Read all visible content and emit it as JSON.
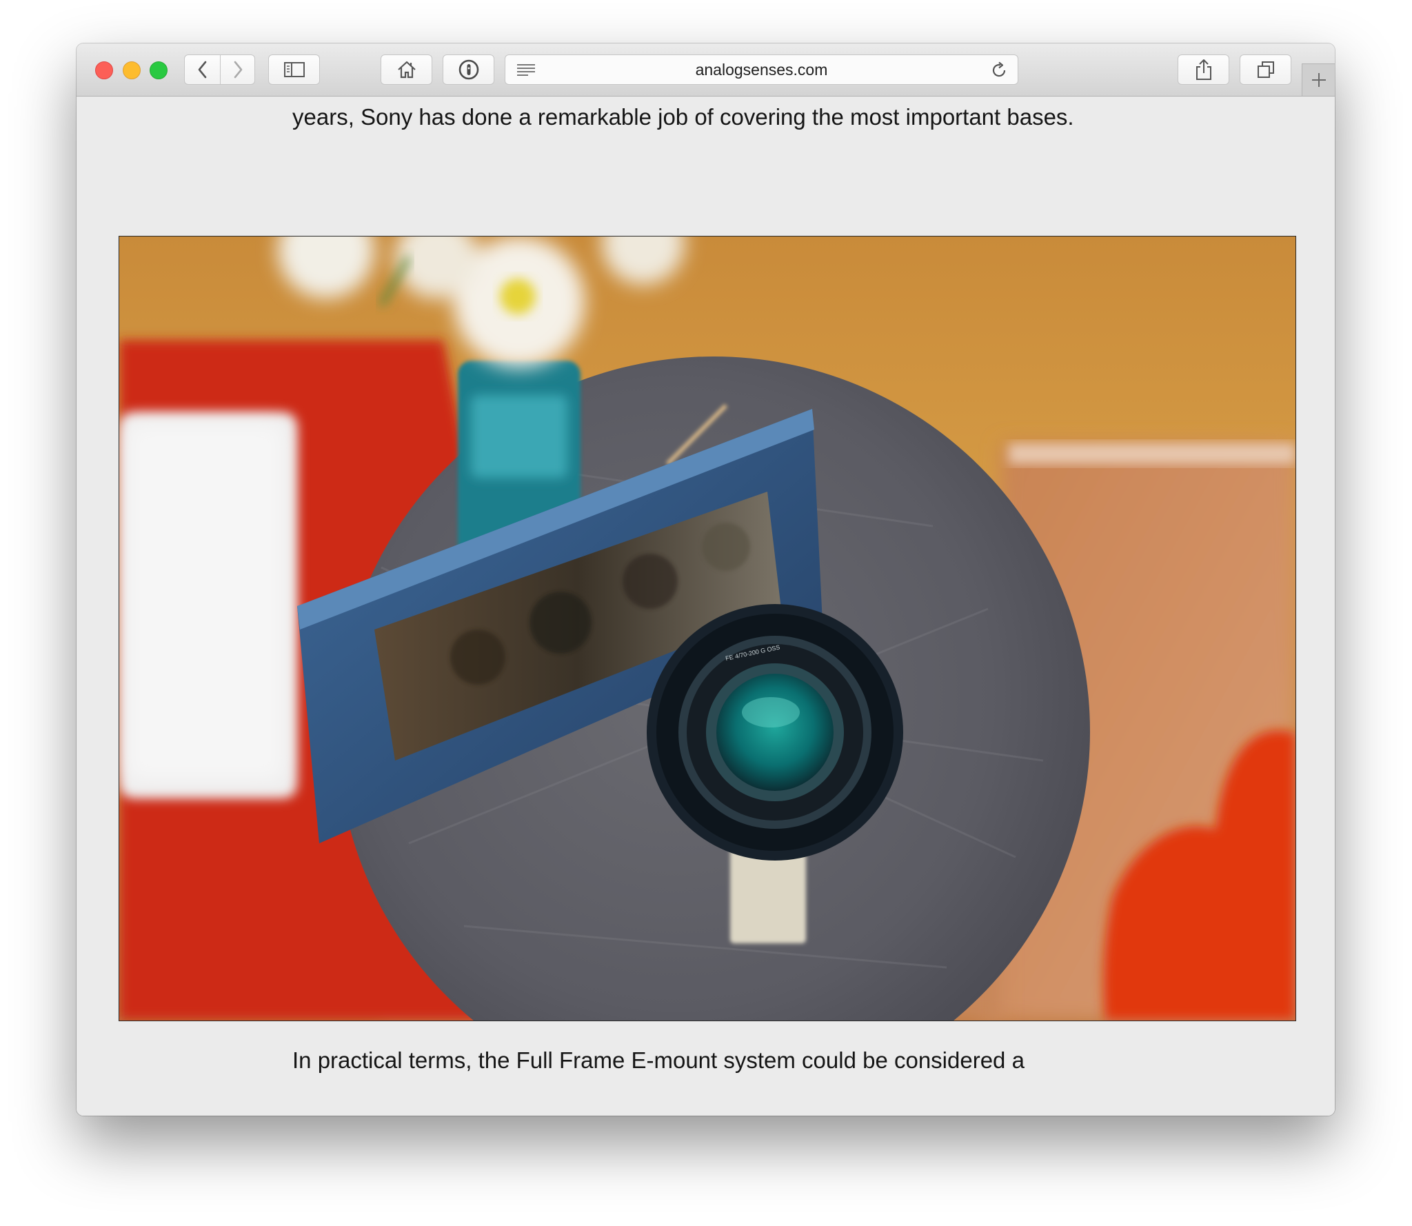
{
  "browser": {
    "url": "analogsenses.com"
  },
  "article": {
    "paragraph_top": "years, Sony has done a remarkable job of covering the most important bases.",
    "paragraph_bottom": "In practical terms, the Full Frame E-mount system could be considered a"
  },
  "photo": {
    "lens_text": "FE 4/70-200 G OSS"
  },
  "colors": {
    "traffic_close": "#fc5f57",
    "traffic_minimize": "#fdbc2e",
    "traffic_zoom": "#29c941",
    "page_background": "#ebebeb"
  },
  "icons": {
    "back": "chevron-left-icon",
    "forward": "chevron-right-icon",
    "sidebar": "sidebar-icon",
    "home": "home-icon",
    "password": "keyhole-icon",
    "reader": "reader-lines-icon",
    "reload": "reload-icon",
    "share": "share-icon",
    "tabs": "tabs-overview-icon",
    "new_tab": "plus-icon"
  }
}
